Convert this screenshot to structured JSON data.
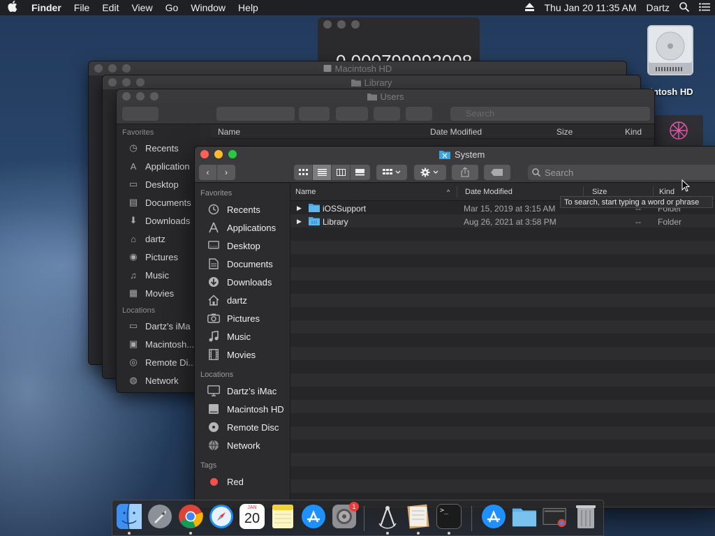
{
  "menubar": {
    "apple": "",
    "app": "Finder",
    "items": [
      "File",
      "Edit",
      "View",
      "Go",
      "Window",
      "Help"
    ],
    "clock": "Thu Jan 20  11:35 AM",
    "user": "Dartz"
  },
  "desktop": {
    "hd_label": "cintosh HD"
  },
  "calculator": {
    "display": "0.000799992008"
  },
  "bg_windows": {
    "macintosh_hd": "Macintosh HD",
    "library": "Library",
    "users": "Users"
  },
  "users_window": {
    "search_placeholder": "Search",
    "columns": [
      "Name",
      "Date Modified",
      "Size",
      "Kind"
    ],
    "favorites_head": "Favorites",
    "favorites": [
      "Recents",
      "Application",
      "Desktop",
      "Documents",
      "Downloads",
      "dartz",
      "Pictures",
      "Music",
      "Movies"
    ],
    "locations_head": "Locations",
    "locations": [
      "Dartz's iMa",
      "Macintosh...",
      "Remote Di...",
      "Network"
    ]
  },
  "front_window": {
    "title": "System",
    "search_placeholder": "Search",
    "columns": {
      "name": "Name",
      "date": "Date Modified",
      "size": "Size",
      "kind": "Kind"
    },
    "sidebar": {
      "favorites_head": "Favorites",
      "favorites": [
        {
          "label": "Recents",
          "icon": "clock-icon"
        },
        {
          "label": "Applications",
          "icon": "applications-icon"
        },
        {
          "label": "Desktop",
          "icon": "desktop-icon"
        },
        {
          "label": "Documents",
          "icon": "document-icon"
        },
        {
          "label": "Downloads",
          "icon": "download-icon"
        },
        {
          "label": "dartz",
          "icon": "home-icon"
        },
        {
          "label": "Pictures",
          "icon": "camera-icon"
        },
        {
          "label": "Music",
          "icon": "music-icon"
        },
        {
          "label": "Movies",
          "icon": "film-icon"
        }
      ],
      "locations_head": "Locations",
      "locations": [
        {
          "label": "Dartz’s iMac",
          "icon": "imac-icon"
        },
        {
          "label": "Macintosh HD",
          "icon": "disk-icon"
        },
        {
          "label": "Remote Disc",
          "icon": "disc-icon"
        },
        {
          "label": "Network",
          "icon": "network-icon"
        }
      ],
      "tags_head": "Tags",
      "tags": [
        {
          "label": "Red",
          "color": "#f4504a"
        }
      ]
    },
    "files": [
      {
        "name": "iOSSupport",
        "date": "Mar 15, 2019 at 3:15 AM",
        "size": "--",
        "kind": "Folder"
      },
      {
        "name": "Library",
        "date": "Aug 26, 2021 at 3:58 PM",
        "size": "--",
        "kind": "Folder"
      }
    ]
  },
  "tooltip": "To search, start typing a word or phrase",
  "dock": {
    "calendar_month": "JAN",
    "calendar_day": "20",
    "badge": "1",
    "terminal_prompt": ">_"
  }
}
